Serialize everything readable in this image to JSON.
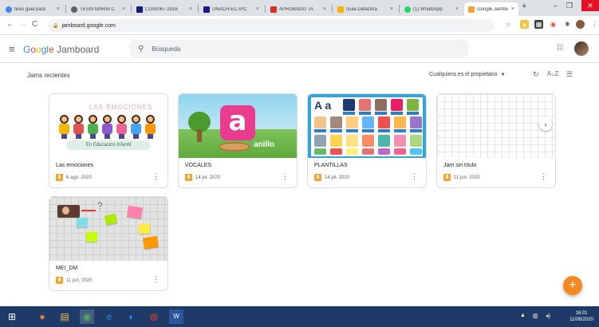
{
  "browser": {
    "tabs": [
      {
        "title": "tesis guia para",
        "favicon_color": "#4285f4",
        "active": false
      },
      {
        "title": "TESIS MARIA C",
        "favicon_color": "#5f6368",
        "active": false
      },
      {
        "title": "CD00067-2016",
        "favicon_color": "#1a1a80",
        "active": false
      },
      {
        "title": "UNACH-EC-IPC",
        "favicon_color": "#1a1a80",
        "active": false
      },
      {
        "title": "APROBADO TA",
        "favicon_color": "#d93025",
        "active": false
      },
      {
        "title": "Guia Didactica",
        "favicon_color": "#f4b400",
        "active": false
      },
      {
        "title": "(1) WhatsApp",
        "favicon_color": "#25d366",
        "active": false
      },
      {
        "title": "Google Jambo",
        "favicon_color": "#f6a235",
        "active": true
      }
    ],
    "tab_close": "×",
    "new_tab": "+",
    "url": "jamboard.google.com"
  },
  "app": {
    "logo_google_letters": [
      "G",
      "o",
      "o",
      "g",
      "l",
      "e"
    ],
    "logo_product": "Jamboard",
    "search_placeholder": "Búsqueda"
  },
  "section": {
    "title": "Jams recientes",
    "owner_filter": "Cualquiera es el propietario"
  },
  "jams": [
    {
      "title": "Las emociones",
      "date": "6 ago. 2020",
      "thumb_header": "LAS EMOCIONES",
      "thumb_caption": "En Educación Infantil"
    },
    {
      "title": "VOCALES",
      "date": "14 jul. 2020",
      "thumb_letter": "a",
      "thumb_word": "anillo"
    },
    {
      "title": "PLANTILLAS",
      "date": "14 jul. 2020",
      "thumb_letters": "A a"
    },
    {
      "title": "Jam sin título",
      "date": "11 jun. 2020"
    },
    {
      "title": "MEI_DM",
      "date": "11 jun. 2020"
    }
  ],
  "fab_label": "+",
  "taskbar": {
    "time": "16:01",
    "date": "11/08/2020"
  },
  "colors": {
    "jam_orange": "#f6a235",
    "fab": "#f4891f",
    "taskbar": "#1e3a66"
  }
}
